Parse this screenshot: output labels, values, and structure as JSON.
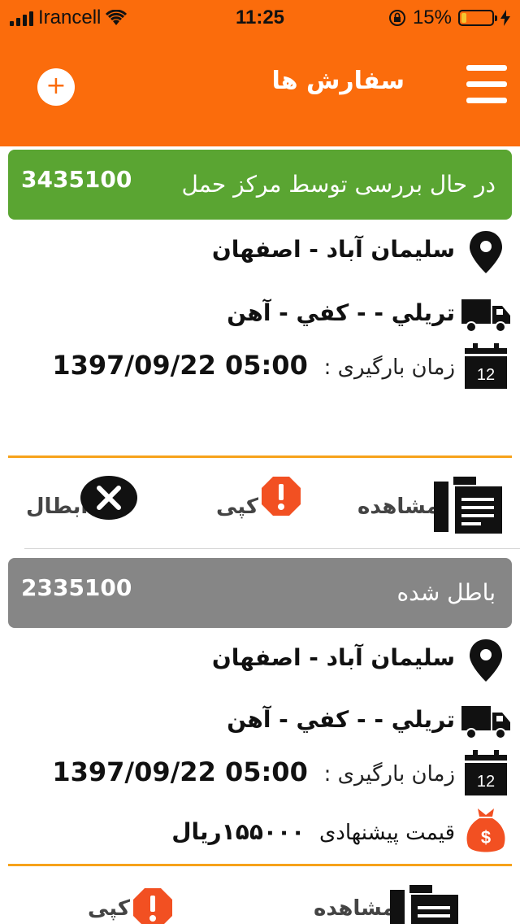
{
  "statusbar": {
    "carrier": "Irancell",
    "time": "11:25",
    "battery": "15%",
    "battery_level": 0.15
  },
  "header": {
    "title": "سفارش ها",
    "add_icon": "plus-icon",
    "menu_icon": "hamburger-icon"
  },
  "colors": {
    "header": "#fb6c0c",
    "status_reviewing": "#5aa532",
    "status_cancelled": "#868686",
    "divider": "#f7a21a"
  },
  "orders": [
    {
      "id": "3435100",
      "status": "در حال بررسی توسط مرکز حمل",
      "route": "سليمان آباد - اصفهان",
      "cargo": "تريلي -  - کفي - آهن",
      "load_label": "زمان بارگیری :",
      "load_time": "1397/09/22 05:00",
      "calendar_day": "12",
      "actions": {
        "view": "مشاهده",
        "copy": "کپی",
        "cancel": "ابطال"
      }
    },
    {
      "id": "2335100",
      "status": "باطل شده",
      "route": "سليمان آباد - اصفهان",
      "cargo": "تريلي -  - کفي - آهن",
      "load_label": "زمان بارگیری :",
      "load_time": "1397/09/22 05:00",
      "calendar_day": "12",
      "price_label": "قیمت پیشنهادی",
      "price_value": "۱۵۵۰۰۰ریال",
      "actions": {
        "view": "مشاهده",
        "copy": "کپی"
      }
    }
  ]
}
